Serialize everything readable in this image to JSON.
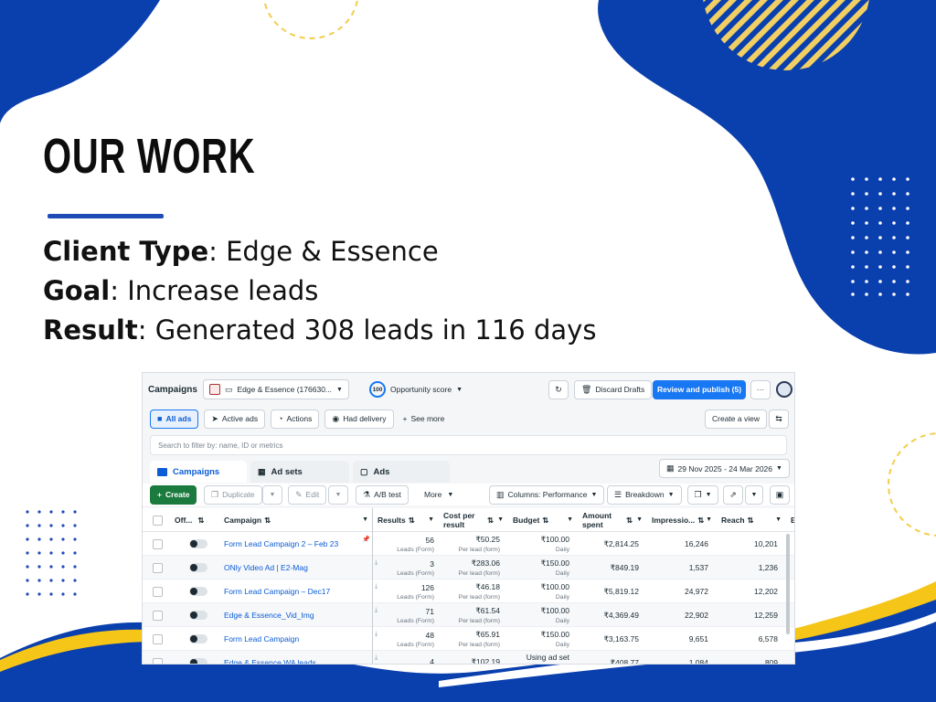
{
  "slide": {
    "heading": "OUR WORK",
    "lines": [
      {
        "label": "Client Type",
        "value": ": Edge & Essence"
      },
      {
        "label": "Goal",
        "value": ": Increase leads"
      },
      {
        "label": "Result",
        "value": ": Generated 308 leads in 116 days"
      }
    ],
    "colors": {
      "blue": "#0a3fae",
      "yellow": "#f5c518",
      "dark": "#0d0d0d"
    }
  },
  "app": {
    "title": "Campaigns",
    "account": "Edge & Essence (176630...",
    "opportunity_score": "100",
    "opportunity_label": "Opportunity score",
    "discard_drafts": "Discard Drafts",
    "review_publish": "Review and publish (5)",
    "more": "···",
    "filters": [
      "All ads",
      "Active ads",
      "Actions",
      "Had delivery",
      "See more"
    ],
    "create_view": "Create a view",
    "search_placeholder": "Search to filter by: name, ID or metrics",
    "tabs": [
      "Campaigns",
      "Ad sets",
      "Ads"
    ],
    "date_range": "29 Nov 2025 - 24 Mar 2026",
    "toolbar": {
      "create": "Create",
      "duplicate": "Duplicate",
      "edit": "Edit",
      "ab_test": "A/B test",
      "more": "More",
      "columns": "Columns: Performance",
      "breakdown": "Breakdown"
    },
    "columns": [
      "Off...",
      "Campaign",
      "Results",
      "Cost per result",
      "Budget",
      "Amount spent",
      "Impressio...",
      "Reach",
      "E"
    ],
    "rows": [
      {
        "campaign": "Form Lead Campaign 2 – Feb 23",
        "results": "56",
        "results_sub": "Leads (Form)",
        "cpr": "₹50.25",
        "cpr_sub": "Per lead (form)",
        "budget": "₹100.00",
        "budget_sub": "Daily",
        "spent": "₹2,814.25",
        "impressions": "16,246",
        "reach": "10,201"
      },
      {
        "campaign": "ONly Video Ad | E2-Mag",
        "results": "3",
        "results_sub": "Leads (Form)",
        "cpr": "₹283.06",
        "cpr_sub": "Per lead (form)",
        "budget": "₹150.00",
        "budget_sub": "Daily",
        "spent": "₹849.19",
        "impressions": "1,537",
        "reach": "1,236"
      },
      {
        "campaign": "Form Lead Campaign – Dec17",
        "results": "126",
        "results_sub": "Leads (Form)",
        "cpr": "₹46.18",
        "cpr_sub": "Per lead (form)",
        "budget": "₹100.00",
        "budget_sub": "Daily",
        "spent": "₹5,819.12",
        "impressions": "24,972",
        "reach": "12,202"
      },
      {
        "campaign": "Edge & Essence_Vid_Img",
        "results": "71",
        "results_sub": "Leads (Form)",
        "cpr": "₹61.54",
        "cpr_sub": "Per lead (form)",
        "budget": "₹100.00",
        "budget_sub": "Daily",
        "spent": "₹4,369.49",
        "impressions": "22,902",
        "reach": "12,259"
      },
      {
        "campaign": "Form Lead Campaign",
        "results": "48",
        "results_sub": "Leads (Form)",
        "cpr": "₹65.91",
        "cpr_sub": "Per lead (form)",
        "budget": "₹150.00",
        "budget_sub": "Daily",
        "spent": "₹3,163.75",
        "impressions": "9,651",
        "reach": "6,578"
      },
      {
        "campaign": "Edge & Essence WA leads",
        "results": "4",
        "results_sub": "",
        "cpr": "₹102.19",
        "cpr_sub": "",
        "budget": "Using ad set bu...",
        "budget_sub": "",
        "spent": "₹408.77",
        "impressions": "1,084",
        "reach": "809"
      }
    ]
  }
}
